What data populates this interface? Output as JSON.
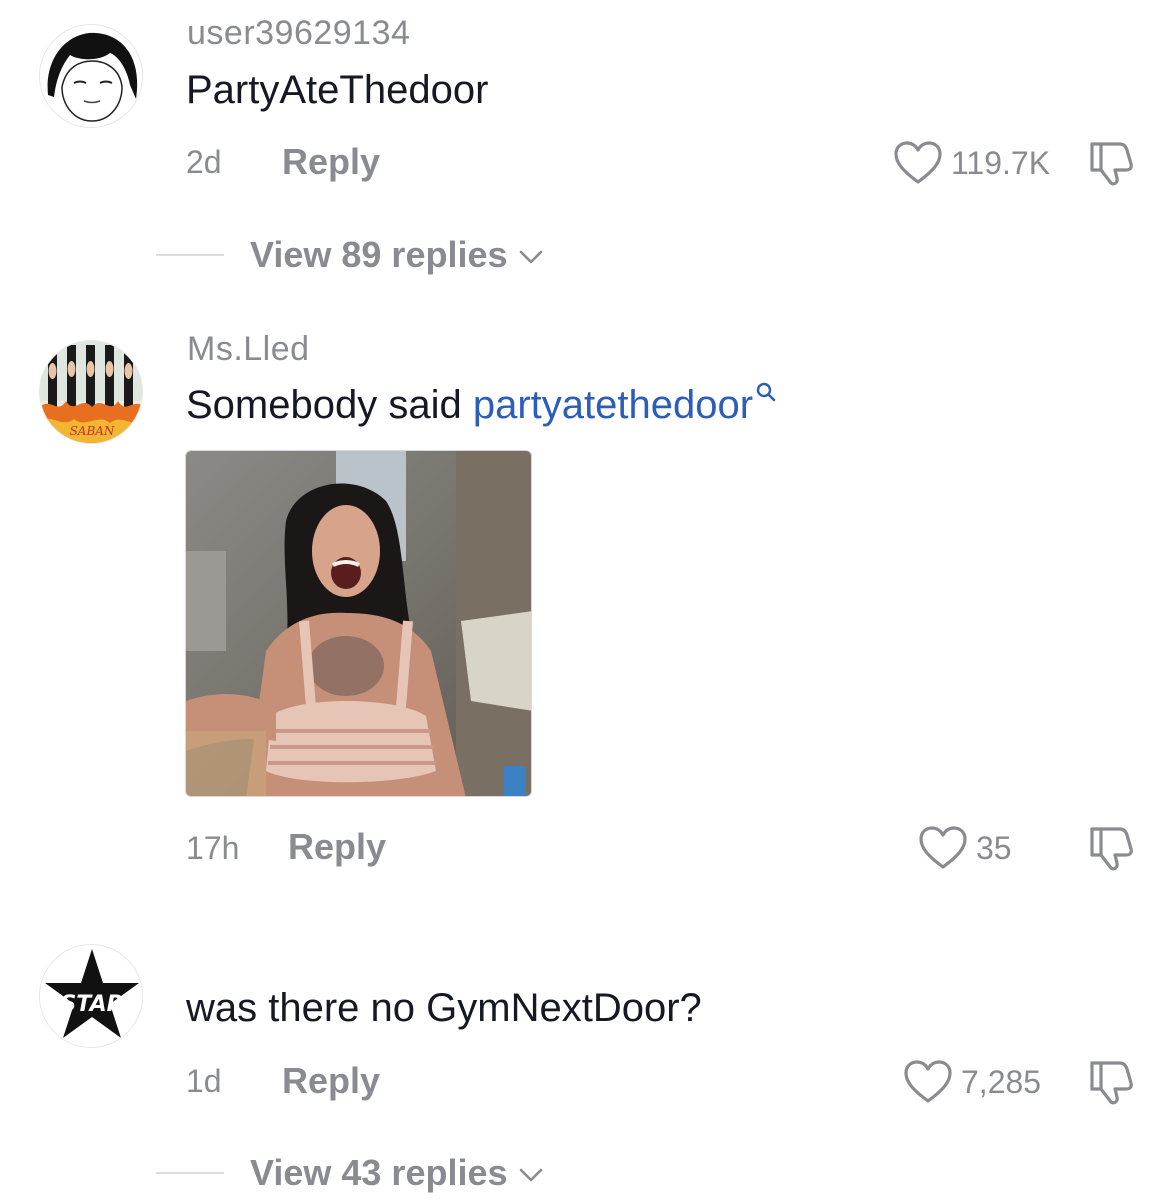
{
  "comments": [
    {
      "username": "user39629134",
      "text": "PartyAteThedoor",
      "time": "2d",
      "reply_label": "Reply",
      "likes": "119.7K",
      "view_replies": "View 89 replies"
    },
    {
      "username": "Ms.Lled",
      "text_prefix": "Somebody said ",
      "mention": "partyatethedoor",
      "time": "17h",
      "reply_label": "Reply",
      "likes": "35",
      "avatar_text": "SABAN"
    },
    {
      "username": "",
      "text": "was there no GymNextDoor?",
      "time": "1d",
      "reply_label": "Reply",
      "likes": "7,285",
      "view_replies": "View 43 replies",
      "avatar_text": "STAR"
    }
  ],
  "icons": {
    "like": "heart-outline-icon",
    "dislike": "thumbs-down-icon",
    "expand": "chevron-down-icon",
    "search": "search-icon"
  },
  "colors": {
    "text_primary": "#161823",
    "text_secondary": "#8a8b91",
    "mention": "#2b5db9",
    "divider": "#dcdcdc"
  }
}
